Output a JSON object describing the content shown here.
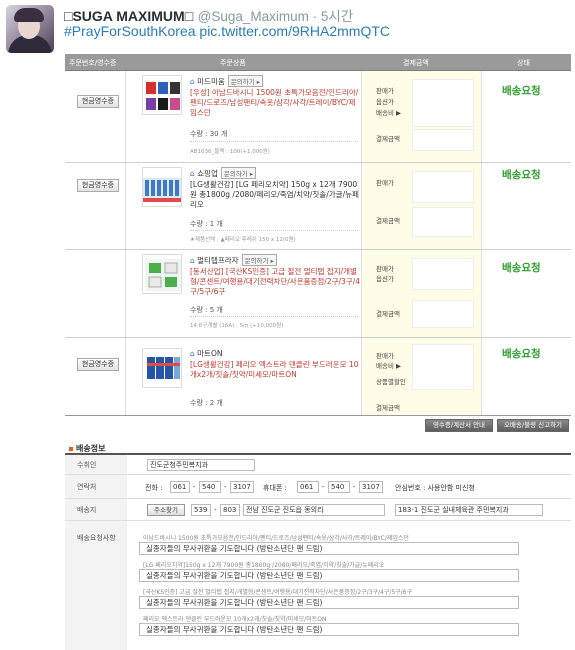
{
  "tweet": {
    "name": "□SUGA MAXIMUM□",
    "handle": "@Suga_Maximum · 5시간",
    "text": "#PrayForSouthKorea pic.twitter.com/9RHA2mmQTC"
  },
  "order_table": {
    "headers": [
      "주문번호/영수증",
      "주문상품",
      "결제금액",
      "상태"
    ],
    "ask_label": "문의하기 ▸",
    "cash_receipt_label": "현금영수증",
    "rows": [
      {
        "seller": "미드미움",
        "product": "[우성] 아남드바시니 1500원 초특가모음전/인드리아/펜티/드로즈/남성팬티/속옷/삼각/사각/트레이/BYC/제임스던",
        "quantity": "수량 : 30 개",
        "option": "AB1036_블랙 : 100(+1,000원)",
        "pay_labels": [
          "판매가",
          "옵션가",
          "배송비 ▶",
          "결제금액"
        ],
        "status": "배송요청"
      },
      {
        "seller": "쇼핑업",
        "product": "[LG생활건강] [LG 페리오치약] 150g x 12개 7900원 총1800g /2080/페리오/죽염/치약/칫솔/가글/뉴페리오",
        "quantity": "수량 : 1 개",
        "option": "★제품선택 : ▲페리오 후레쉬 150 x 12(0원)",
        "pay_labels": [
          "판매가",
          "결제금액"
        ],
        "status": "배송요청"
      },
      {
        "seller": "멀티탭프라자",
        "product": "[동서산업] [국산KS인증] 고급 절전 멀티탭 접지/개별형/콘센트/여행용/대기전력차단/사은품증정/2구/3구/4구/5구/6구",
        "quantity": "수량 : 5 개",
        "option": "14.6구개별 (16A) : 5m (+10,000원)",
        "pay_labels": [
          "판매가",
          "옵션가",
          "결제금액"
        ],
        "status": "배송요청"
      },
      {
        "seller": "마트ON",
        "product": "[LG생활건강] 페리오 엑스트라 덴클린 부드러운모 10개x2개/칫솔/칫약/미세모/마트ON",
        "quantity": "수량 : 2 개",
        "option": "",
        "pay_labels": [
          "판매가",
          "배송비 ▶",
          "상품별할인",
          "결제금액"
        ],
        "status": "배송요청"
      }
    ],
    "buttons": [
      "영수증/계산서 안내",
      "오배송/불량 신고하기"
    ]
  },
  "shipping": {
    "title": "배송정보",
    "recipient_label": "수취인",
    "recipient": "진도군청주민복지과",
    "contact_label": "연락처",
    "phone_label": "전화 :",
    "phone": [
      "061",
      "540",
      "3107"
    ],
    "mobile_label": "휴대폰 :",
    "mobile": [
      "061",
      "540",
      "3107"
    ],
    "safe_number": "안심번호 : 사용안함 미신청",
    "address_label": "배송지",
    "address_button": "주소찾기",
    "zip": [
      "539",
      "803"
    ],
    "address1": "전남 진도군 진도읍 동외리",
    "address2": "183-1 진도군 실내체육관 주민복지과",
    "request_label": "배송요청사항",
    "requests": [
      {
        "item": "아남드바시니 1500원 초특가모음전/인드리아/펜티/드로즈/남성팬티/속옷/삼각/사각/트레이/BYC/제임스던",
        "message": "실종자들의 무사귀환을 기도합니다 (방탄소년단 팬 드림)"
      },
      {
        "item": "[LG 페리오치약]150g x 12개 7900원 총1800g /2080/페리오/죽염/치약/칫솔/가글/뉴페리오",
        "message": "실종자들의 무사귀환을 기도합니다 (방탄소년단 팬 드림)"
      },
      {
        "item": "[국산KS인증] 고급 절전 멀티탭 접지/개별형/콘센트/여행용/대기전력차단/사은품증정/2구/3구/4구/5구/6구",
        "message": "실종자들의 무사귀환을 기도합니다 (방탄소년단 팬 드림)"
      },
      {
        "item": "페리오 엑스트라 덴클린 부드러운모 10개x2개/칫솔/칫약/미세모/마트ON",
        "message": "실종자들의 무사귀환을 기도합니다 (방탄소년단 팬 드림)"
      }
    ]
  },
  "colors": {
    "status_green": "#2e9e2e",
    "product_red": "#c0392b",
    "link_blue": "#2b7bb9",
    "header_gray": "#9a9a9a"
  }
}
